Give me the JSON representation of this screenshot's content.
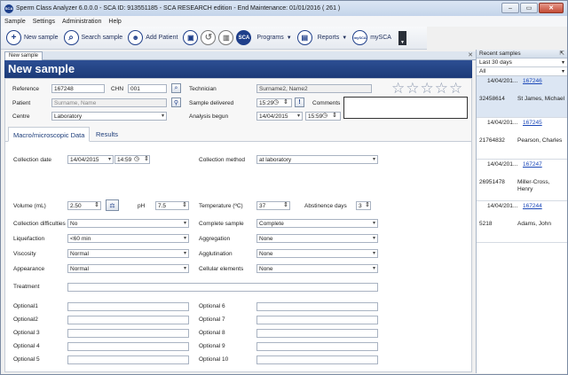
{
  "titlebar": {
    "title": "Sperm Class Analyzer 6.0.0.0 - SCA ID: 913551185 - SCA RESEARCH edition - End Maintenance: 01/01/2016 ( 261 )",
    "app_icon": "SCA"
  },
  "menu": [
    "Sample",
    "Settings",
    "Administration",
    "Help"
  ],
  "toolbar": {
    "new_sample": "New sample",
    "search_sample": "Search sample",
    "add_patient": "Add Patient",
    "sca": "SCA",
    "programs": "Programs",
    "reports": "Reports",
    "mysca_icon": "mySCA",
    "mysca": "mySCA"
  },
  "doc_tab": "New sample",
  "header": "New sample",
  "form": {
    "reference_label": "Reference",
    "reference": "167248",
    "chn_label": "CHN",
    "chn": "001",
    "patient_label": "Patient",
    "patient_placeholder": "Surname, Name",
    "centre_label": "Centre",
    "centre": "Laboratory",
    "technician_label": "Technician",
    "technician": "Surname2, Name2",
    "sample_delivered_label": "Sample delivered",
    "sample_delivered_time": "15:29",
    "comments_label": "Comments",
    "analysis_begun_label": "Analysis begun",
    "analysis_date": "14/04/2015",
    "analysis_time": "15:59"
  },
  "subtabs": [
    "Macro/microscopic Data",
    "Results"
  ],
  "macro": {
    "collection_date_label": "Collection date",
    "collection_date": "14/04/2015",
    "collection_time": "14:59",
    "collection_method_label": "Collection method",
    "collection_method": "at laboratory",
    "volume_label": "Volume (mL)",
    "volume": "2.50",
    "ph_label": "pH",
    "ph": "7.5",
    "temperature_label": "Temperature (ºC)",
    "temperature": "37",
    "abstinence_label": "Abstinence days",
    "abstinence": "3",
    "collection_difficulties_label": "Collection difficulties",
    "collection_difficulties": "No",
    "complete_sample_label": "Complete sample",
    "complete_sample": "Complete",
    "liquefaction_label": "Liquefaction",
    "liquefaction": "<60 min",
    "aggregation_label": "Aggregation",
    "aggregation": "None",
    "viscosity_label": "Viscosity",
    "viscosity": "Normal",
    "agglutination_label": "Agglutination",
    "agglutination": "None",
    "appearance_label": "Appearance",
    "appearance": "Normal",
    "cellular_label": "Cellular elements",
    "cellular": "None",
    "treatment_label": "Treatment",
    "optional_left": [
      "Optional1",
      "Optional2",
      "Optional 3",
      "Optional 4",
      "Optional 5"
    ],
    "optional_right": [
      "Optional 6",
      "Optional 7",
      "Optional 8",
      "Optional 9",
      "Optional 10"
    ]
  },
  "recent": {
    "title": "Recent samples",
    "range": "Last 30 days",
    "filter": "All",
    "items": [
      {
        "date": "14/04/201...",
        "ref": "167246",
        "id": "32458614",
        "name": "St James, Michael"
      },
      {
        "date": "14/04/201...",
        "ref": "167245",
        "id": "21764832",
        "name": "Pearson, Charles"
      },
      {
        "date": "14/04/201...",
        "ref": "167247",
        "id": "26951478",
        "name": "Miller-Cross, Henry"
      },
      {
        "date": "14/04/201...",
        "ref": "167244",
        "id": "5218",
        "name": "Adams, John"
      }
    ]
  },
  "colors": {
    "header": "#1c3a78",
    "accent": "#1f3f8a",
    "link": "#1a47b8"
  }
}
